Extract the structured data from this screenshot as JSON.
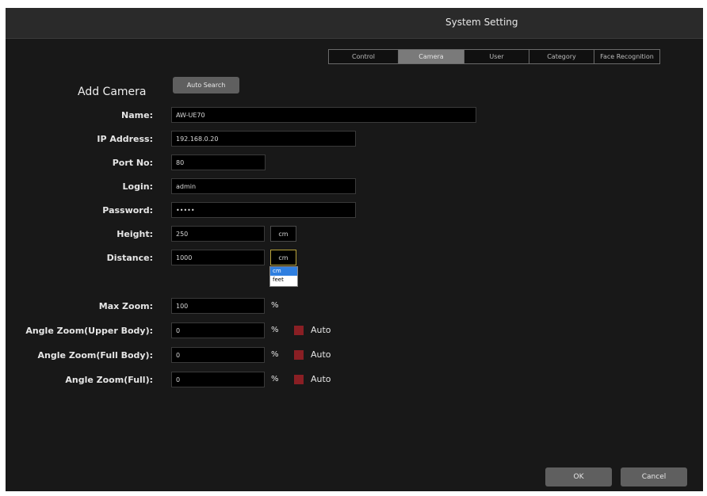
{
  "window": {
    "title": "System Setting"
  },
  "tabs": [
    "Control",
    "Camera",
    "User",
    "Category",
    "Face Recognition"
  ],
  "active_tab": "Camera",
  "section": {
    "title": "Add Camera",
    "auto_search_label": "Auto Search"
  },
  "form": {
    "name": {
      "label": "Name:",
      "value": "AW-UE70"
    },
    "ip": {
      "label": "IP Address:",
      "value": "192.168.0.20"
    },
    "port": {
      "label": "Port No:",
      "value": "80"
    },
    "login": {
      "label": "Login:",
      "value": "admin"
    },
    "password": {
      "label": "Password:",
      "value": "•••••"
    },
    "height": {
      "label": "Height:",
      "value": "250",
      "unit": "cm"
    },
    "distance": {
      "label": "Distance:",
      "value": "1000",
      "unit": "cm",
      "unit_options": [
        "cm",
        "feet"
      ],
      "unit_options_selected": "cm"
    },
    "max_zoom": {
      "label": "Max Zoom:",
      "value": "100",
      "unit": "%"
    },
    "angle_upper": {
      "label": "Angle Zoom(Upper Body):",
      "value": "0",
      "unit": "%",
      "auto_label": "Auto",
      "auto_checked": false
    },
    "angle_full_body": {
      "label": "Angle Zoom(Full Body):",
      "value": "0",
      "unit": "%",
      "auto_label": "Auto",
      "auto_checked": false
    },
    "angle_full": {
      "label": "Angle Zoom(Full):",
      "value": "0",
      "unit": "%",
      "auto_label": "Auto",
      "auto_checked": false
    }
  },
  "buttons": {
    "ok": "OK",
    "cancel": "Cancel"
  },
  "colors": {
    "checkbox": "#8a1f24",
    "active_tab": "#7a7a7a",
    "dropdown_selected": "#2f7fe0"
  }
}
